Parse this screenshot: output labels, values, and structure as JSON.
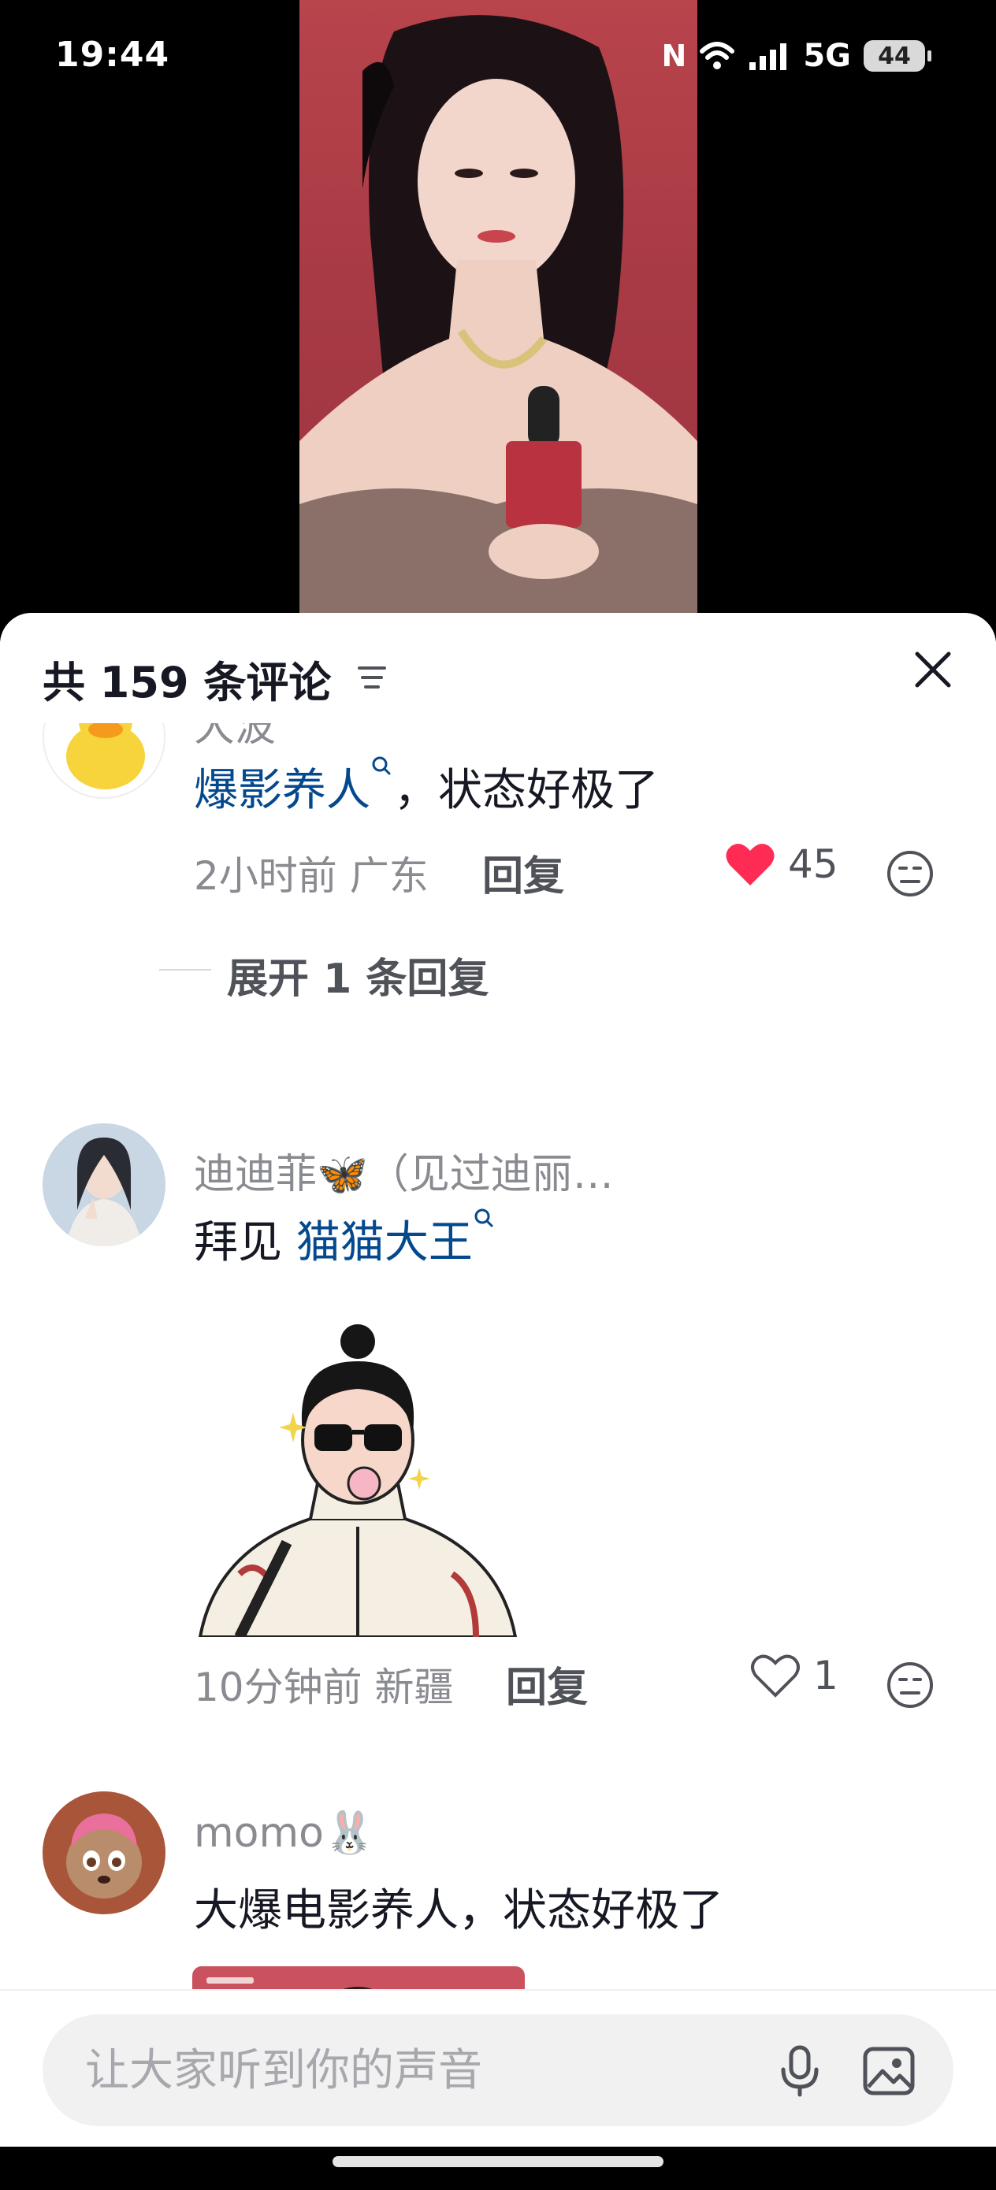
{
  "status_bar": {
    "time": "19:44",
    "network": "5G",
    "battery": "44"
  },
  "sheet": {
    "title": "共 159 条评论"
  },
  "comments": [
    {
      "username": "大波",
      "text_link": "爆影养人",
      "text_rest": "，状态好极了",
      "time": "2小时前",
      "location": "广东",
      "reply_label": "回复",
      "likes": "45",
      "liked": true,
      "expand_label": "展开 1 条回复"
    },
    {
      "username": "迪迪菲🦋（见过迪丽…",
      "text_plain": "拜见",
      "text_link": "猫猫大王",
      "time": "10分钟前",
      "location": "新疆",
      "reply_label": "回复",
      "likes": "1",
      "liked": false
    },
    {
      "username": "momo🐰",
      "text_plain": "大爆电影养人，状态好极了"
    }
  ],
  "input": {
    "placeholder": "让大家听到你的声音"
  },
  "icons": {
    "sort": "filter-lines-icon",
    "close": "close-icon",
    "heart_filled": "heart-filled-icon",
    "heart_outline": "heart-outline-icon",
    "dislike": "dislike-face-icon",
    "search_hint": "search-hint-icon",
    "mic": "microphone-icon",
    "image": "image-icon"
  },
  "colors": {
    "link": "#04498d",
    "like_red": "#fe2c55",
    "muted": "#8a8b91"
  }
}
